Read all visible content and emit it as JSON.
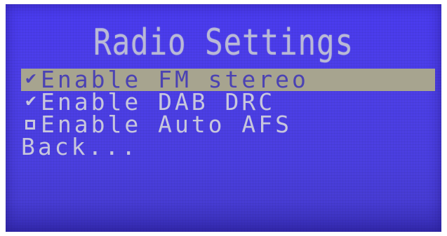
{
  "screen": {
    "title": "Radio Settings",
    "colors": {
      "background": "#4a3bf0",
      "text": "#c7c6dd",
      "selection": "#a7a48f",
      "selected_text": "#4b42b3"
    }
  },
  "menu": {
    "items": [
      {
        "check": "✔",
        "label": "Enable FM stereo",
        "checked": true,
        "selected": true
      },
      {
        "check": "✔",
        "label": "Enable DAB DRC",
        "checked": true,
        "selected": false
      },
      {
        "check": "",
        "label": "Enable Auto AFS",
        "checked": false,
        "selected": false
      }
    ],
    "back_label": "Back..."
  }
}
